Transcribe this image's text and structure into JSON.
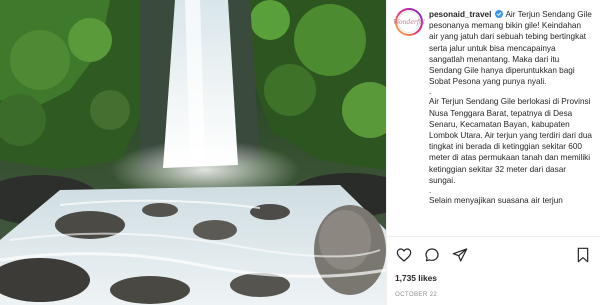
{
  "post": {
    "username": "pesonaid_travel",
    "avatar_text": "Wonderful",
    "caption_paragraph_1": "Air Terjun Sendang Gile pesonanya memang bikin gile! Keindahan air yang jatuh dari sebuah tebing bertingkat serta jalur untuk bisa mencapainya sangatlah menantang. Maka dari itu Sendang Gile hanya diperuntukkan bagi Sobat Pesona yang punya nyali.",
    "separator": ".",
    "caption_paragraph_2": "Air Terjun Sendang Gile berlokasi di Provinsi Nusa Tenggara Barat, tepatnya di Desa Senaru, Kecamatan Bayan, kabupaten Lombok Utara. Air terjun yang terdiri dari dua tingkat ini berada di ketinggian sekitar 600 meter di atas permukaan tanah dan memiliki ketinggian sekitar 32 meter dari dasar sungai.",
    "caption_paragraph_3": "Selain menyajikan suasana air terjun",
    "likes": "1,735 likes",
    "date": "OCTOBER 22"
  },
  "icons": {
    "verified": "verified-badge-icon",
    "like": "heart-icon",
    "comment": "comment-icon",
    "share": "share-icon",
    "save": "bookmark-icon"
  },
  "colors": {
    "text": "#262626",
    "muted": "#8e8e8e",
    "verified": "#3897f0",
    "border": "#efefef"
  }
}
